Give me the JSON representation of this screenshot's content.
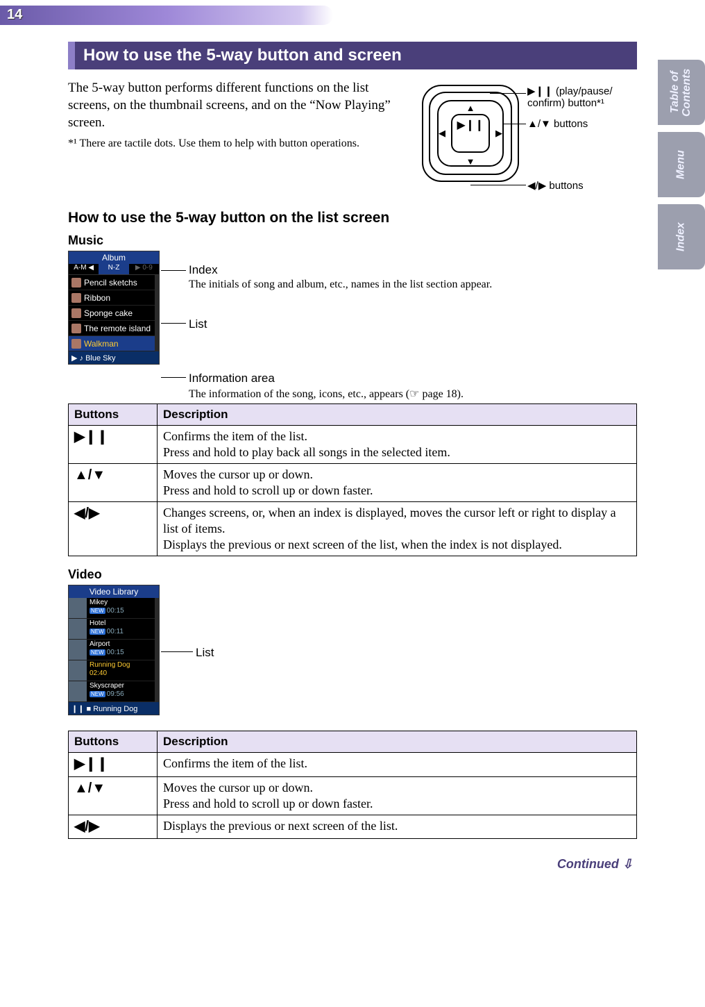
{
  "page_number": "14",
  "side_tabs": [
    "Table of\nContents",
    "Menu",
    "Index"
  ],
  "section_title": "How to use the 5-way button and screen",
  "intro_paragraph": "The 5-way button performs different functions on the list screens, on the thumbnail screens, and on the “Now Playing” screen.",
  "footnote": "*¹ There are tactile dots. Use them to help with button operations.",
  "diagram": {
    "play_label": "▶❙❙ (play/pause/\nconfirm) button*¹",
    "updown_label": "▲/▼ buttons",
    "leftright_label": "◀/▶ buttons"
  },
  "subsection_title": "How to use the 5-way button on the list screen",
  "music": {
    "heading": "Music",
    "screen_title": "Album",
    "index_tabs": [
      "A-M ◀",
      "N-Z",
      "▶ 0-9"
    ],
    "list_items": [
      "Pencil sketchs",
      "Ribbon",
      "Sponge cake",
      "The remote island",
      "Walkman"
    ],
    "selected_index": 4,
    "info_bar": "▶ ♪ Blue Sky",
    "labels": {
      "index": "Index",
      "index_desc": "The initials of song and album, etc., names in the list section appear.",
      "list": "List",
      "info": "Information area",
      "info_desc": "The information of the song, icons, etc., appears (☞ page 18)."
    }
  },
  "table_headers": {
    "buttons": "Buttons",
    "description": "Description"
  },
  "music_table": [
    {
      "button": "▶❙❙",
      "desc": "Confirms the item of the list.\nPress and hold to play back all songs in the selected item."
    },
    {
      "button": "▲/▼",
      "desc": "Moves the cursor up or down.\nPress and hold to scroll up or down faster."
    },
    {
      "button": "◀/▶",
      "desc": "Changes screens, or, when an index is displayed, moves the cursor left or right to display a list of items.\nDisplays the previous or next screen of the list, when the index is not displayed."
    }
  ],
  "video": {
    "heading": "Video",
    "screen_title": "Video Library",
    "items": [
      {
        "name": "Mikey",
        "time": "00:15",
        "new": true
      },
      {
        "name": "Hotel",
        "time": "00:11",
        "new": true
      },
      {
        "name": "Airport",
        "time": "00:15",
        "new": true
      },
      {
        "name": "Running Dog",
        "time": "02:40",
        "new": false,
        "selected": true
      },
      {
        "name": "Skyscraper",
        "time": "09:56",
        "new": true
      }
    ],
    "info_bar": "❙❙ ■ Running Dog",
    "list_label": "List"
  },
  "video_table": [
    {
      "button": "▶❙❙",
      "desc": "Confirms the item of the list."
    },
    {
      "button": "▲/▼",
      "desc": "Moves the cursor up or down.\nPress and hold to scroll up or down faster."
    },
    {
      "button": "◀/▶",
      "desc": "Displays the previous or next screen of the list."
    }
  ],
  "continued": "Continued ⇩"
}
